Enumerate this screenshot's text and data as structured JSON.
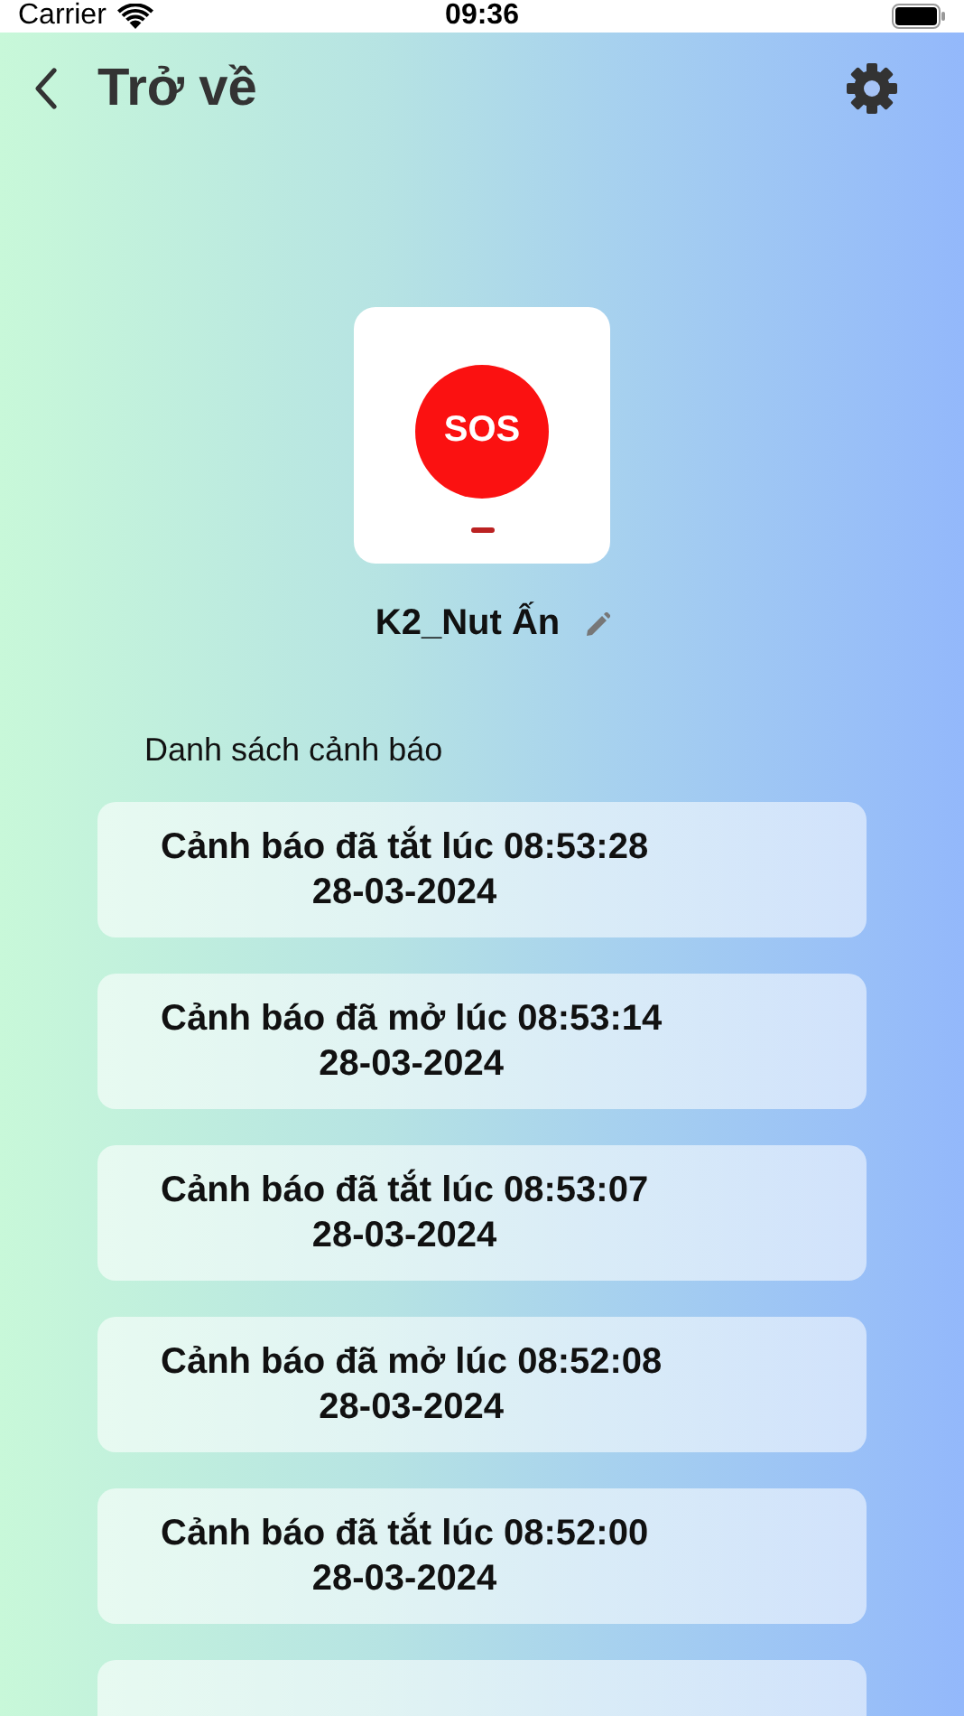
{
  "status_bar": {
    "carrier": "Carrier",
    "time": "09:36"
  },
  "nav": {
    "back_label": "Trở về"
  },
  "device": {
    "name": "K2_Nut Ấn",
    "button_text": "SOS"
  },
  "section_title": "Danh sách cảnh báo",
  "alerts": [
    {
      "text": "Cảnh báo đã tắt lúc 08:53:28",
      "date": "28-03-2024"
    },
    {
      "text": "Cảnh báo đã mở lúc 08:53:14",
      "date": "28-03-2024"
    },
    {
      "text": "Cảnh báo đã tắt lúc 08:53:07",
      "date": "28-03-2024"
    },
    {
      "text": "Cảnh báo đã mở lúc 08:52:08",
      "date": "28-03-2024"
    },
    {
      "text": "Cảnh báo đã tắt lúc 08:52:00",
      "date": "28-03-2024"
    }
  ],
  "more_cards_below": true
}
